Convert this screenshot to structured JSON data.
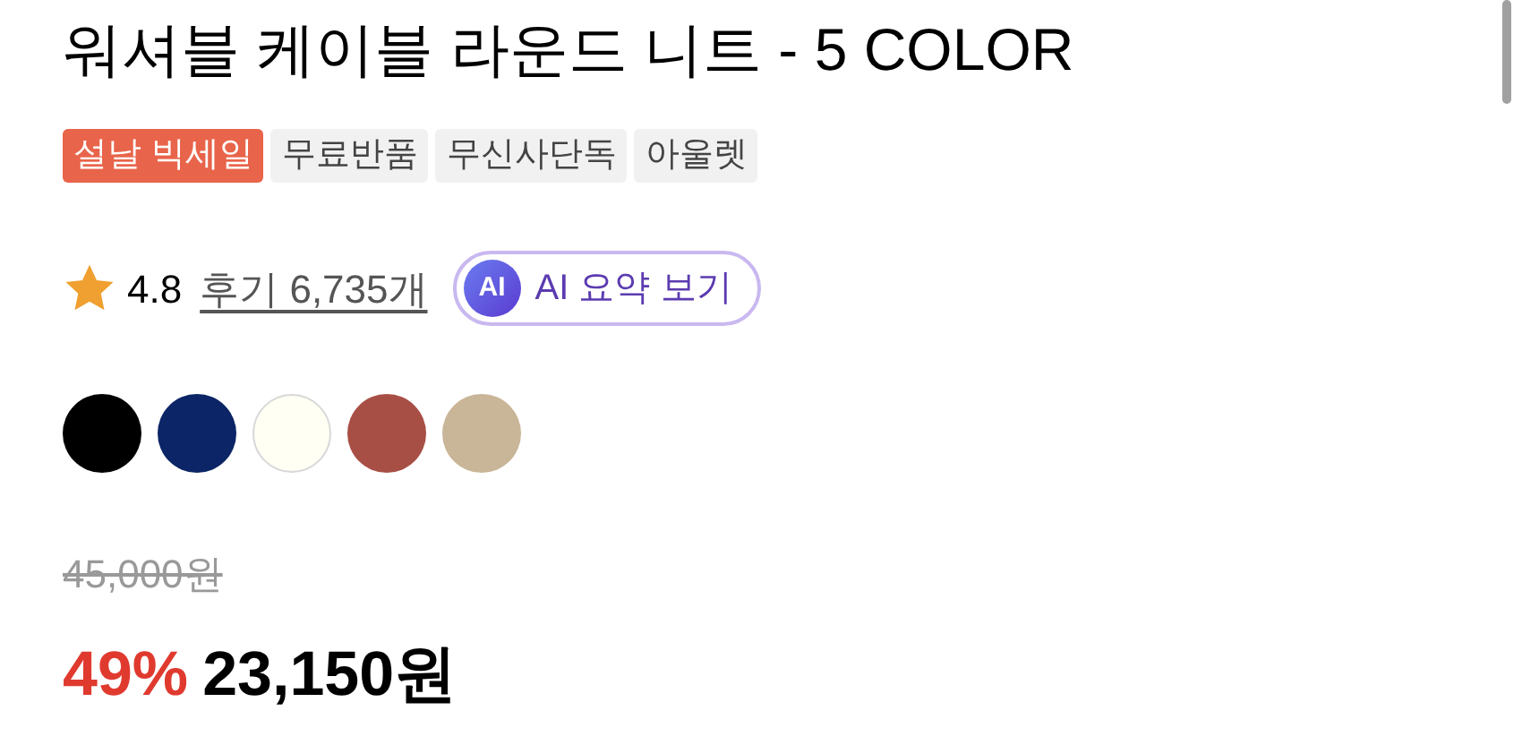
{
  "title": "워셔블 케이블 라운드 니트 - 5 COLOR",
  "tags": [
    {
      "label": "설날 빅세일",
      "kind": "sale"
    },
    {
      "label": "무료반품",
      "kind": "plain"
    },
    {
      "label": "무신사단독",
      "kind": "plain"
    },
    {
      "label": "아울렛",
      "kind": "plain"
    }
  ],
  "rating": {
    "score": "4.8",
    "reviews": "후기 6,735개"
  },
  "ai_button": {
    "badge": "AI",
    "label": "AI 요약 보기"
  },
  "swatches": [
    {
      "color": "#000000"
    },
    {
      "color": "#0b2566"
    },
    {
      "color": "#fffff4"
    },
    {
      "color": "#a84f45"
    },
    {
      "color": "#c9b597"
    }
  ],
  "price": {
    "original": "45,000원",
    "discount": "49%",
    "final": "23,150원"
  }
}
